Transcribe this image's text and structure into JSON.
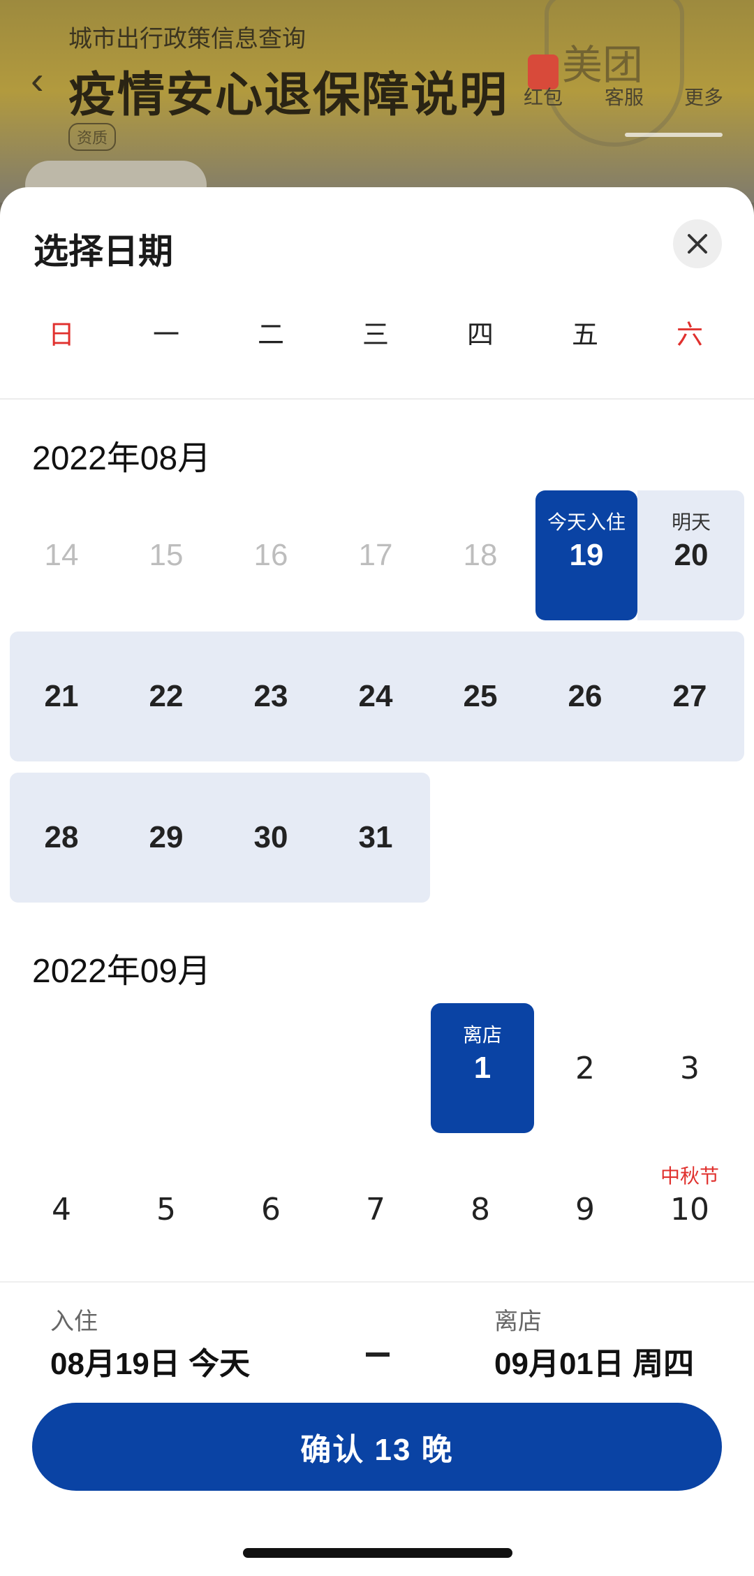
{
  "background": {
    "subtitle": "城市出行政策信息查询",
    "title": "疫情安心退保障说明",
    "tag": "资质",
    "brand": "美团",
    "actions": [
      "红包",
      "客服",
      "更多"
    ]
  },
  "sheet": {
    "title": "选择日期",
    "weekdays": [
      "日",
      "一",
      "二",
      "三",
      "四",
      "五",
      "六"
    ]
  },
  "months": [
    {
      "label": "2022年08月",
      "days": {
        "d14": "14",
        "d15": "15",
        "d16": "16",
        "d17": "17",
        "d18": "18",
        "d19": "19",
        "d19_label": "今天入住",
        "d20": "20",
        "d20_label": "明天",
        "d21": "21",
        "d22": "22",
        "d23": "23",
        "d24": "24",
        "d25": "25",
        "d26": "26",
        "d27": "27",
        "d28": "28",
        "d29": "29",
        "d30": "30",
        "d31": "31"
      }
    },
    {
      "label": "2022年09月",
      "days": {
        "d1": "1",
        "d1_label": "离店",
        "d2": "2",
        "d3": "3",
        "d4": "4",
        "d5": "5",
        "d6": "6",
        "d7": "7",
        "d8": "8",
        "d9": "9",
        "d10": "10",
        "d10_label": "中秋节"
      }
    }
  ],
  "footer": {
    "checkin_label": "入住",
    "checkin_value": "08月19日 今天",
    "checkout_label": "离店",
    "checkout_value": "09月01日 周四",
    "confirm_label": "确认 13 晚"
  },
  "colors": {
    "accent": "#0a43a4",
    "range": "#e6ebf5",
    "holiday": "#e0312e"
  }
}
